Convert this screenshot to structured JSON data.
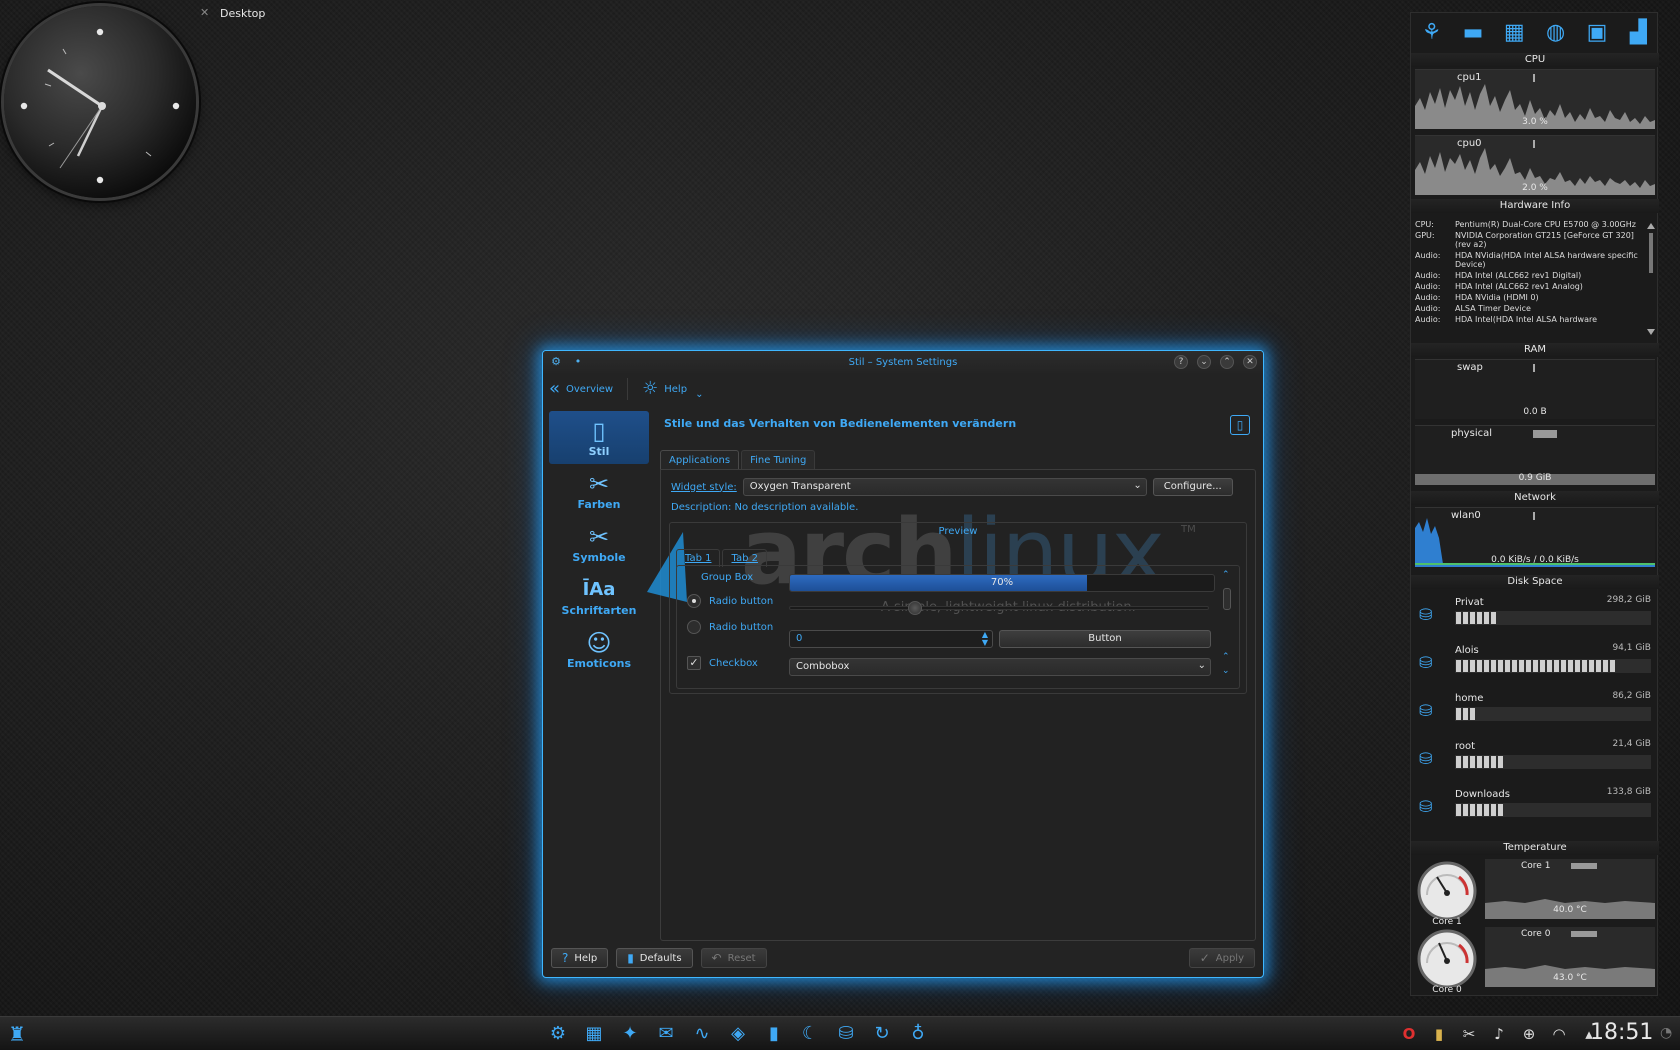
{
  "desktop": {
    "label": "Desktop"
  },
  "window": {
    "title": "Stil – System Settings",
    "toolbar": {
      "overview": "Overview",
      "help": "Help"
    },
    "sidebar": [
      {
        "label": "Stil",
        "icon": "style-icon"
      },
      {
        "label": "Farben",
        "icon": "tools-icon"
      },
      {
        "label": "Symbole",
        "icon": "tools-icon"
      },
      {
        "label": "Schriftarten",
        "icon": "fonts-icon"
      },
      {
        "label": "Emoticons",
        "icon": "smiley-icon"
      }
    ],
    "heading": "Stile und das Verhalten von Bedienelementen verändern",
    "tabs": [
      "Applications",
      "Fine Tuning"
    ],
    "widget_style_label": "Widget style:",
    "widget_style_value": "Oxygen Transparent",
    "configure": "Configure...",
    "description": "Description: No description available.",
    "watermark": {
      "text_a": "arch",
      "text_b": "linux",
      "tm": "TM",
      "tagline": "A simple, lightweight linux distribution."
    },
    "preview": {
      "title": "Preview",
      "tabs": [
        "Tab 1",
        "Tab 2"
      ],
      "groupbox": "Group Box",
      "radio1": "Radio button",
      "radio2": "Radio button",
      "checkbox": "Checkbox",
      "progress_text": "70%",
      "progress_value": 0.7,
      "slider_value": 0.3,
      "spin_value": "0",
      "button": "Button",
      "combobox": "Combobox"
    },
    "footer": {
      "help": "Help",
      "defaults": "Defaults",
      "reset": "Reset",
      "apply": "Apply"
    }
  },
  "monitor": {
    "cpu_title": "CPU",
    "cpu1": {
      "name": "cpu1",
      "value": "3.0 %"
    },
    "cpu0": {
      "name": "cpu0",
      "value": "2.0 %"
    },
    "hw_title": "Hardware Info",
    "hw": [
      {
        "k": "CPU:",
        "v": "Pentium(R) Dual-Core CPU E5700 @ 3.00GHz"
      },
      {
        "k": "GPU:",
        "v": "NVIDIA Corporation GT215 [GeForce GT 320] (rev a2)"
      },
      {
        "k": "Audio:",
        "v": "HDA NVidia(HDA Intel ALSA hardware specific Device)"
      },
      {
        "k": "Audio:",
        "v": "HDA Intel (ALC662 rev1 Digital)"
      },
      {
        "k": "Audio:",
        "v": "HDA Intel (ALC662 rev1 Analog)"
      },
      {
        "k": "Audio:",
        "v": "HDA NVidia (HDMI 0)"
      },
      {
        "k": "Audio:",
        "v": "ALSA Timer Device"
      },
      {
        "k": "Audio:",
        "v": "HDA Intel(HDA Intel ALSA hardware"
      }
    ],
    "ram_title": "RAM",
    "swap": {
      "name": "swap",
      "value": "0.0 B"
    },
    "physical": {
      "name": "physical",
      "value": "0.9 GiB"
    },
    "network_title": "Network",
    "wlan": {
      "name": "wlan0",
      "value": "0.0 KiB/s / 0.0 KiB/s"
    },
    "disk_title": "Disk Space",
    "disks": [
      {
        "name": "Privat",
        "size": "298,2 GiB",
        "fill": 0.22
      },
      {
        "name": "Alois",
        "size": "94,1 GiB",
        "fill": 0.85
      },
      {
        "name": "home",
        "size": "86,2 GiB",
        "fill": 0.12
      },
      {
        "name": "root",
        "size": "21,4 GiB",
        "fill": 0.26
      },
      {
        "name": "Downloads",
        "size": "133,8 GiB",
        "fill": 0.26
      }
    ],
    "temp_title": "Temperature",
    "temps": [
      {
        "gauge": "Core 1",
        "name": "Core 1",
        "value": "40.0 °C"
      },
      {
        "gauge": "Core 0",
        "name": "Core 0",
        "value": "43.0 °C"
      }
    ]
  },
  "taskbar": {
    "time": "18:51"
  }
}
